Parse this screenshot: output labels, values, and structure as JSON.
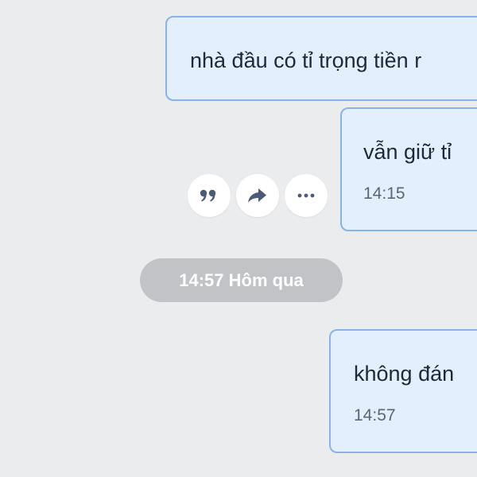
{
  "messages": [
    {
      "text": "nhà đầu có tỉ trọng tiền r",
      "time": ""
    },
    {
      "text": "vẫn giữ tỉ",
      "time": "14:15"
    },
    {
      "text": "không đán",
      "time": "14:57"
    }
  ],
  "message_actions": [
    {
      "icon": "quote-icon"
    },
    {
      "icon": "forward-icon"
    },
    {
      "icon": "more-icon"
    }
  ],
  "date_separator": "14:57 Hôm qua",
  "colors": {
    "background": "#ebecee",
    "bubble_fill": "#e3effd",
    "bubble_border": "#8ab2e8",
    "icon": "#4a5a77",
    "separator": "#c2c3c6"
  }
}
